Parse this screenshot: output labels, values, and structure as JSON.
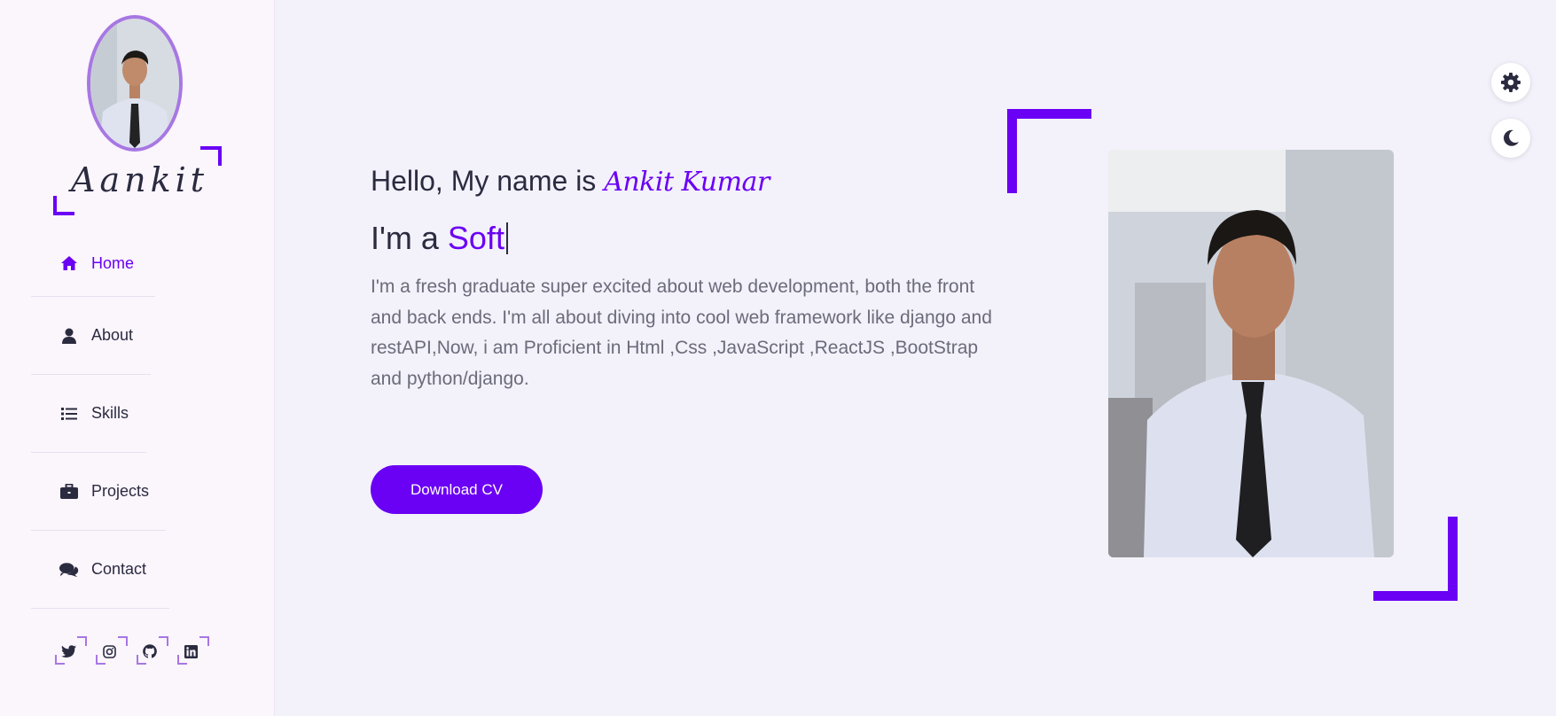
{
  "sidebar": {
    "logo": "Aankit",
    "nav": [
      {
        "label": "Home",
        "icon": "home-icon",
        "active": true
      },
      {
        "label": "About",
        "icon": "user-icon",
        "active": false
      },
      {
        "label": "Skills",
        "icon": "list-icon",
        "active": false
      },
      {
        "label": "Projects",
        "icon": "briefcase-icon",
        "active": false
      },
      {
        "label": "Contact",
        "icon": "comments-icon",
        "active": false
      }
    ],
    "social": [
      "twitter-icon",
      "instagram-icon",
      "github-icon",
      "linkedin-icon"
    ]
  },
  "hero": {
    "greeting": "Hello, My name is",
    "name": "Ankit Kumar",
    "role_prefix": "I'm a",
    "role_typed": "Soft",
    "description": "I'm a fresh graduate super excited about web development, both the front and back ends. I'm all about diving into cool web framework like django and restAPI,Now, i am Proficient in Html ,Css ,JavaScript ,ReactJS ,BootStrap and python/django.",
    "cv_button": "Download CV"
  },
  "controls": [
    "settings-gear-icon",
    "dark-mode-moon-icon"
  ],
  "colors": {
    "accent": "#6a00f4",
    "accent_light": "#a777e3",
    "text": "#2b2b40",
    "muted": "#6b6b7a"
  }
}
